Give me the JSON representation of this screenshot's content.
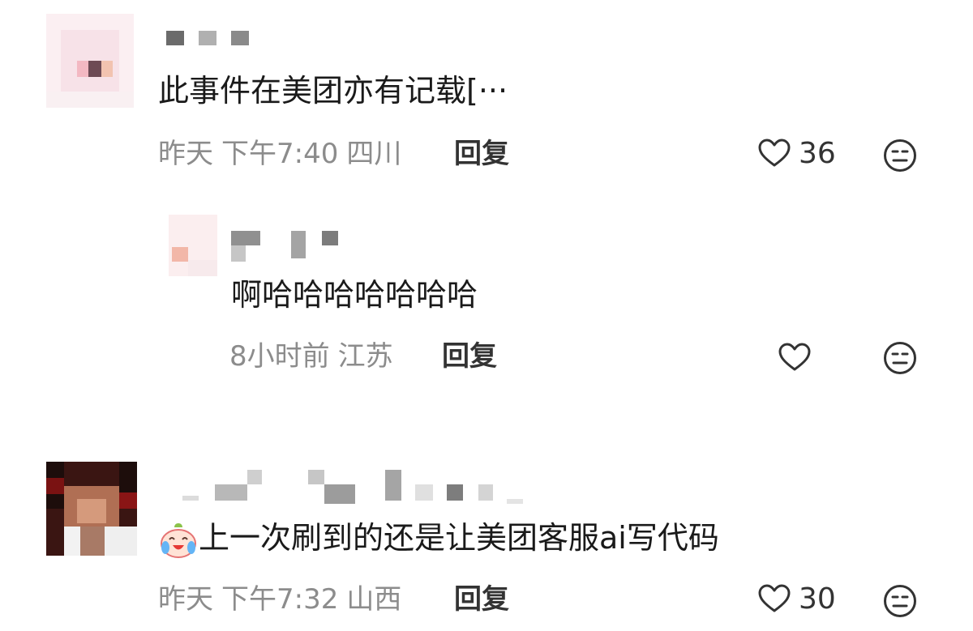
{
  "comments": [
    {
      "text": "此事件在美团亦有记载[···",
      "meta": {
        "date": "昨天",
        "time": "下午7:40",
        "location": "四川"
      },
      "reply_label": "回复",
      "likes": "36",
      "icons": {
        "like": "heart-outline-icon",
        "dislike": "dislike-face-icon"
      }
    },
    {
      "text": "啊哈哈哈哈哈哈哈",
      "meta": {
        "date": "8小时前",
        "location": "江苏"
      },
      "reply_label": "回复",
      "icons": {
        "like": "heart-outline-icon",
        "dislike": "dislike-face-icon"
      }
    },
    {
      "text": "上一次刷到的还是让美团客服ai写代码",
      "emoji": "crying-laughing-emoji",
      "meta": {
        "date": "昨天",
        "time": "下午7:32",
        "location": "山西"
      },
      "reply_label": "回复",
      "likes": "30",
      "icons": {
        "like": "heart-outline-icon",
        "dislike": "dislike-face-icon"
      }
    }
  ],
  "colors": {
    "text": "#1a1a1a",
    "meta": "#8c8c8c",
    "reply": "#333333",
    "background": "#ffffff"
  }
}
